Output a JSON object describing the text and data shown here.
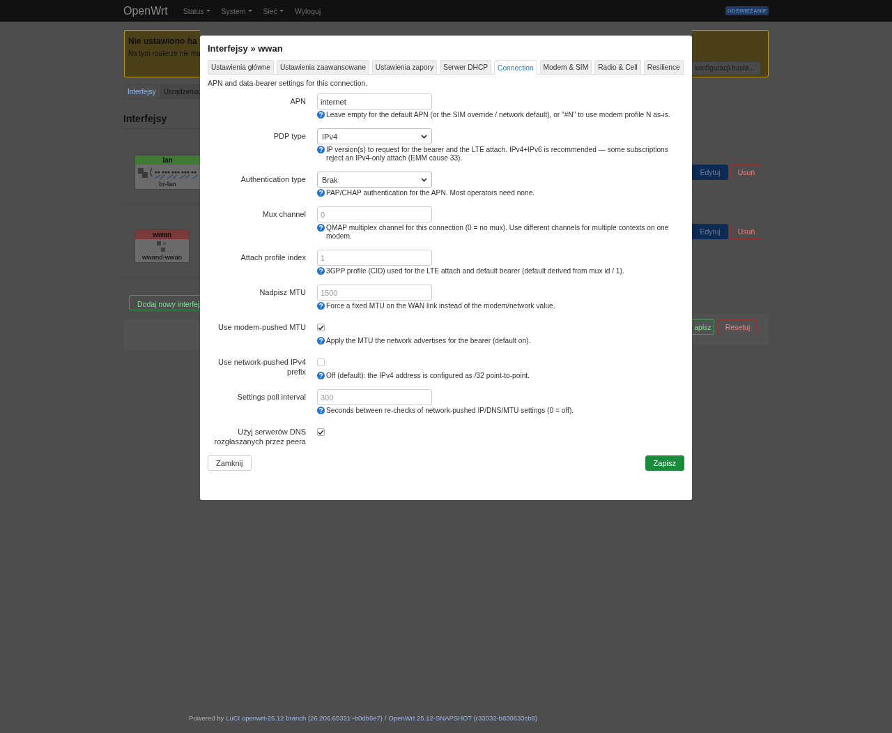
{
  "header": {
    "brand": "OpenWrt",
    "menu": [
      {
        "label": "Status",
        "dropdown": true
      },
      {
        "label": "System",
        "dropdown": true
      },
      {
        "label": "Sieć",
        "dropdown": true
      },
      {
        "label": "Wyloguj",
        "dropdown": false
      }
    ],
    "badge": "ODŚWIEŻANIE"
  },
  "background": {
    "warning": {
      "title": "Nie ustawiono ha",
      "text": "Na tym routerze nie ma",
      "button": "konfiguracji hasła..."
    },
    "tabs": [
      {
        "label": "Interfejsy",
        "selected": true
      },
      {
        "label": "Urządzenia",
        "selected": false
      }
    ],
    "heading": "Interfejsy",
    "interfaces": [
      {
        "name": "lan",
        "color": "#3f7a33",
        "device": "br-lan",
        "kind": "bridge",
        "actions": [
          "Edytuj",
          "Usuń"
        ]
      },
      {
        "name": "wwan",
        "color": "#7a3a3a",
        "device": "wwand-wwan",
        "kind": "modem",
        "actions": [
          "Edytuj",
          "Usuń"
        ]
      }
    ],
    "add_button": "Dodaj nowy interfej",
    "save_button": "apisz",
    "reset_button": "Resetuj"
  },
  "modal": {
    "title": "Interfejsy » wwan",
    "tabs": [
      {
        "label": "Ustawienia główne",
        "selected": false
      },
      {
        "label": "Ustawienia zaawansowane",
        "selected": false
      },
      {
        "label": "Ustawienia zapory",
        "selected": false
      },
      {
        "label": "Serwer DHCP",
        "selected": false
      },
      {
        "label": "Connection",
        "selected": true
      },
      {
        "label": "Modem & SIM",
        "selected": false
      },
      {
        "label": "Radio & Cell",
        "selected": false
      },
      {
        "label": "Resilience",
        "selected": false
      }
    ],
    "description": "APN and data-bearer settings for this connection.",
    "fields": [
      {
        "kind": "text",
        "label": "APN",
        "value": "internet",
        "help": "Leave empty for the default APN (or the SIM override / network default), or \"#N\" to use modem profile N as-is."
      },
      {
        "kind": "select",
        "label": "PDP type",
        "value": "IPv4",
        "help": "IP version(s) to request for the bearer and the LTE attach. IPv4+IPv6 is recommended — some subscriptions reject an IPv4-only attach (EMM cause 33)."
      },
      {
        "kind": "select",
        "label": "Authentication type",
        "value": "Brak",
        "help": "PAP/CHAP authentication for the APN. Most operators need none."
      },
      {
        "kind": "text",
        "label": "Mux channel",
        "placeholder": "0",
        "help": "QMAP multiplex channel for this connection (0 = no mux). Use different channels for multiple contexts on one modem."
      },
      {
        "kind": "text",
        "label": "Attach profile index",
        "placeholder": "1",
        "help": "3GPP profile (CID) used for the LTE attach and default bearer (default derived from mux id / 1)."
      },
      {
        "kind": "text",
        "label": "Nadpisz MTU",
        "placeholder": "1500",
        "help": "Force a fixed MTU on the WAN link instead of the modem/network value."
      },
      {
        "kind": "checkbox",
        "label": "Use modem-pushed MTU",
        "checked": true,
        "help": "Apply the MTU the network advertises for the bearer (default on)."
      },
      {
        "kind": "checkbox",
        "label": "Use network-pushed IPv4 prefix",
        "checked": false,
        "help": "Off (default): the IPv4 address is configured as /32 point-to-point."
      },
      {
        "kind": "text",
        "label": "Settings poll interval",
        "placeholder": "300",
        "help": "Seconds between re-checks of network-pushed IP/DNS/MTU settings (0 = off)."
      },
      {
        "kind": "checkbox",
        "label": "Użyj serwerów DNS rozgłaszanych przez peera",
        "checked": true
      }
    ],
    "close_button": "Zamknij",
    "save_button": "Zapisz"
  },
  "footer": {
    "prefix": "Powered by",
    "links": [
      "LuCI openwrt-25.12 branch (26.206.65321~b0db6e7)",
      "OpenWrt 25.12-SNAPSHOT (r33032-b830633cb8)"
    ],
    "separator": "/"
  }
}
